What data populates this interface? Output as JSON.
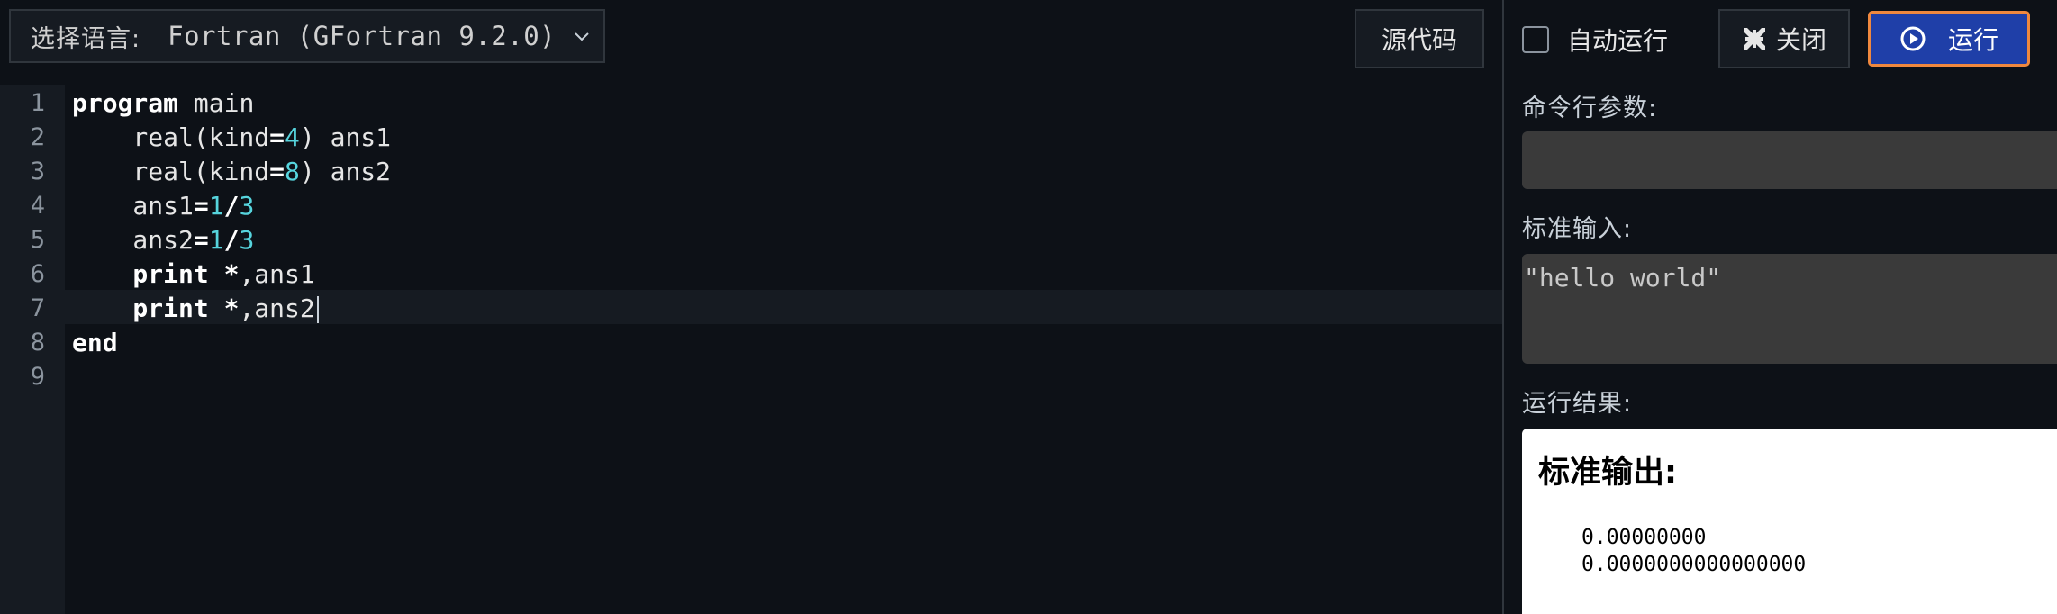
{
  "toolbar": {
    "language_label": "选择语言:",
    "language_value": "Fortran (GFortran 9.2.0)",
    "source_button": "源代码"
  },
  "editor": {
    "line_numbers": [
      "1",
      "2",
      "3",
      "4",
      "5",
      "6",
      "7",
      "8",
      "9"
    ],
    "lines": [
      [
        {
          "t": "program",
          "c": "kw"
        },
        {
          "t": " main",
          "c": ""
        }
      ],
      [
        {
          "t": "    real(kind",
          "c": ""
        },
        {
          "t": "=",
          "c": "op"
        },
        {
          "t": "4",
          "c": "num"
        },
        {
          "t": ") ans1",
          "c": ""
        }
      ],
      [
        {
          "t": "    real(kind",
          "c": ""
        },
        {
          "t": "=",
          "c": "op"
        },
        {
          "t": "8",
          "c": "num"
        },
        {
          "t": ") ans2",
          "c": ""
        }
      ],
      [
        {
          "t": "    ans1",
          "c": ""
        },
        {
          "t": "=",
          "c": "op"
        },
        {
          "t": "1",
          "c": "num"
        },
        {
          "t": "/",
          "c": "op"
        },
        {
          "t": "3",
          "c": "num"
        }
      ],
      [
        {
          "t": "    ans2",
          "c": ""
        },
        {
          "t": "=",
          "c": "op"
        },
        {
          "t": "1",
          "c": "num"
        },
        {
          "t": "/",
          "c": "op"
        },
        {
          "t": "3",
          "c": "num"
        }
      ],
      [
        {
          "t": "    print",
          "c": "kw"
        },
        {
          "t": " ",
          "c": ""
        },
        {
          "t": "*",
          "c": "op"
        },
        {
          "t": ",ans1",
          "c": ""
        }
      ],
      [
        {
          "t": "    print",
          "c": "kw"
        },
        {
          "t": " ",
          "c": ""
        },
        {
          "t": "*",
          "c": "op"
        },
        {
          "t": ",ans2",
          "c": ""
        }
      ],
      [
        {
          "t": "end",
          "c": "kw"
        }
      ],
      []
    ]
  },
  "panel": {
    "auto_run_label": "自动运行",
    "close_label": "关闭",
    "run_label": "运行",
    "args_label": "命令行参数:",
    "args_value": "",
    "stdin_label": "标准输入:",
    "stdin_value": "\"hello world\"",
    "result_label": "运行结果:",
    "result_title": "标准输出:",
    "output_lines": [
      "0.00000000",
      "0.0000000000000000"
    ]
  },
  "colors": {
    "run_button_bg": "#1f3fa8",
    "run_button_border": "#f0883e",
    "number_token": "#56d4dd"
  }
}
